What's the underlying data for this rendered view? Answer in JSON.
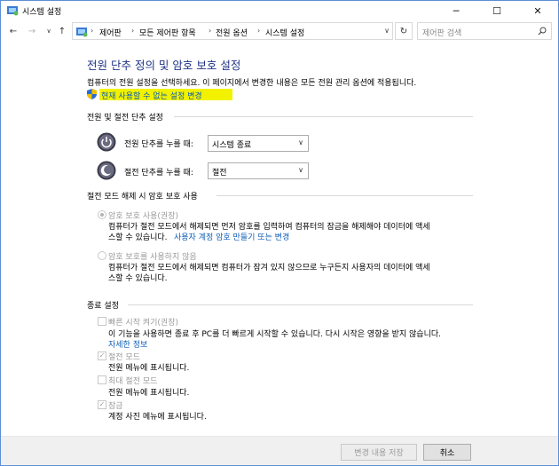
{
  "window": {
    "title": "시스템 설정"
  },
  "window_buttons": {
    "minimize": "─",
    "maximize": "☐",
    "close": "✕"
  },
  "nav": {
    "back": "←",
    "forward": "→",
    "dropdown": "∨",
    "up": "↑"
  },
  "address": {
    "crumbs": [
      "제어판",
      "모든 제어판 항목",
      "전원 옵션",
      "시스템 설정"
    ],
    "separator": "›",
    "dropdown": "∨"
  },
  "refresh_glyph": "↻",
  "search": {
    "placeholder": "제어판 검색"
  },
  "page": {
    "title": "전원 단추 정의 및 암호 보호 설정",
    "description": "컴퓨터의 전원 설정을 선택하세요. 이 페이지에서 변경한 내용은 모든 전원 관리 옵션에 적용됩니다.",
    "change_link": "현재 사용할 수 없는 설정 변경",
    "highlight_color": "#f2f200"
  },
  "buttons_section": {
    "label": "전원 및 절전 단추 설정",
    "power": {
      "label": "전원 단추를 누를 때:",
      "value": "시스템 종료"
    },
    "sleep": {
      "label": "절전 단추를 누를 때:",
      "value": "절전"
    }
  },
  "password_section": {
    "label": "절전 모드 해제 시 암호 보호 사용",
    "require": {
      "label": "암호 보호 사용(권장)",
      "desc_line1": "컴퓨터가 절전 모드에서 해제되면 먼저 암호를 입력하여 컴퓨터의 잠금을 해제해야 데이터에 액세",
      "desc_line2": "스할 수 있습니다.",
      "link": "사용자 계정 암호 만들기 또는 변경"
    },
    "none": {
      "label": "암호 보호를 사용하지 않음",
      "desc_line1": "컴퓨터가 절전 모드에서 해제되면 컴퓨터가 잠겨 있지 않으므로 누구든지 사용자의 데이터에 액세",
      "desc_line2": "스할 수 있습니다."
    }
  },
  "shutdown_section": {
    "label": "종료 설정",
    "fast_startup": {
      "label": "빠른 시작 켜기(권장)",
      "desc": "이 기능을 사용하면 종료 후 PC를 더 빠르게 시작할 수 있습니다. 다시 시작은 영향을 받지 않습니다.",
      "link": "자세한 정보",
      "checked": false
    },
    "sleep": {
      "label": "절전 모드",
      "desc": "전원 메뉴에 표시됩니다.",
      "checked": true
    },
    "hibernate": {
      "label": "최대 절전 모드",
      "desc": "전원 메뉴에 표시됩니다.",
      "checked": false
    },
    "lock": {
      "label": "잠금",
      "desc": "계정 사진 메뉴에 표시됩니다.",
      "checked": true
    }
  },
  "footer": {
    "save": "변경 내용 저장",
    "cancel": "취소"
  },
  "select_arrow": "∨",
  "check_mark": "✓"
}
